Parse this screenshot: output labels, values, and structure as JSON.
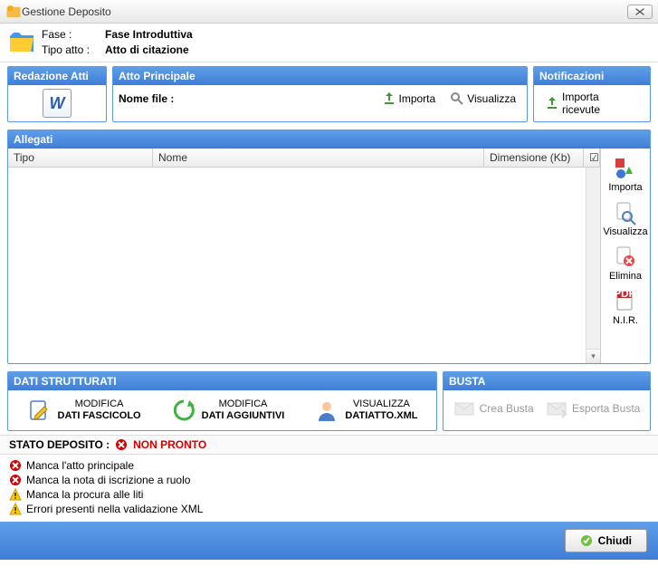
{
  "window": {
    "title": "Gestione Deposito"
  },
  "fase": {
    "label": "Fase :",
    "value": "Fase Introduttiva"
  },
  "tipoAtto": {
    "label": "Tipo atto :",
    "value": "Atto di citazione"
  },
  "redazione": {
    "title": "Redazione Atti"
  },
  "principale": {
    "title": "Atto Principale",
    "nomeFileLabel": "Nome file :",
    "importa": "Importa",
    "visualizza": "Visualizza"
  },
  "notificazioni": {
    "title": "Notificazioni",
    "importaRicevute": "Importa ricevute"
  },
  "allegati": {
    "title": "Allegati",
    "cols": {
      "tipo": "Tipo",
      "nome": "Nome",
      "dim": "Dimensione (Kb)"
    },
    "sideBtns": {
      "importa": "Importa",
      "visualizza": "Visualizza",
      "elimina": "Elimina",
      "nir": "N.I.R."
    }
  },
  "dati": {
    "title": "DATI STRUTTURATI",
    "modFascicolo1": "MODIFICA",
    "modFascicolo2": "DATI FASCICOLO",
    "modAgg1": "MODIFICA",
    "modAgg2": "DATI AGGIUNTIVI",
    "vis1": "VISUALIZZA",
    "vis2": "DATIATTO.XML"
  },
  "busta": {
    "title": "BUSTA",
    "crea": "Crea Busta",
    "esporta": "Esporta Busta"
  },
  "status": {
    "label": "STATO DEPOSITO :",
    "value": "NON PRONTO"
  },
  "messages": [
    {
      "type": "error",
      "text": "Manca l'atto principale"
    },
    {
      "type": "error",
      "text": "Manca la nota di iscrizione a ruolo"
    },
    {
      "type": "warn",
      "text": "Manca la procura alle liti"
    },
    {
      "type": "warn",
      "text": "Errori presenti nella validazione XML"
    }
  ],
  "footer": {
    "chiudi": "Chiudi"
  }
}
